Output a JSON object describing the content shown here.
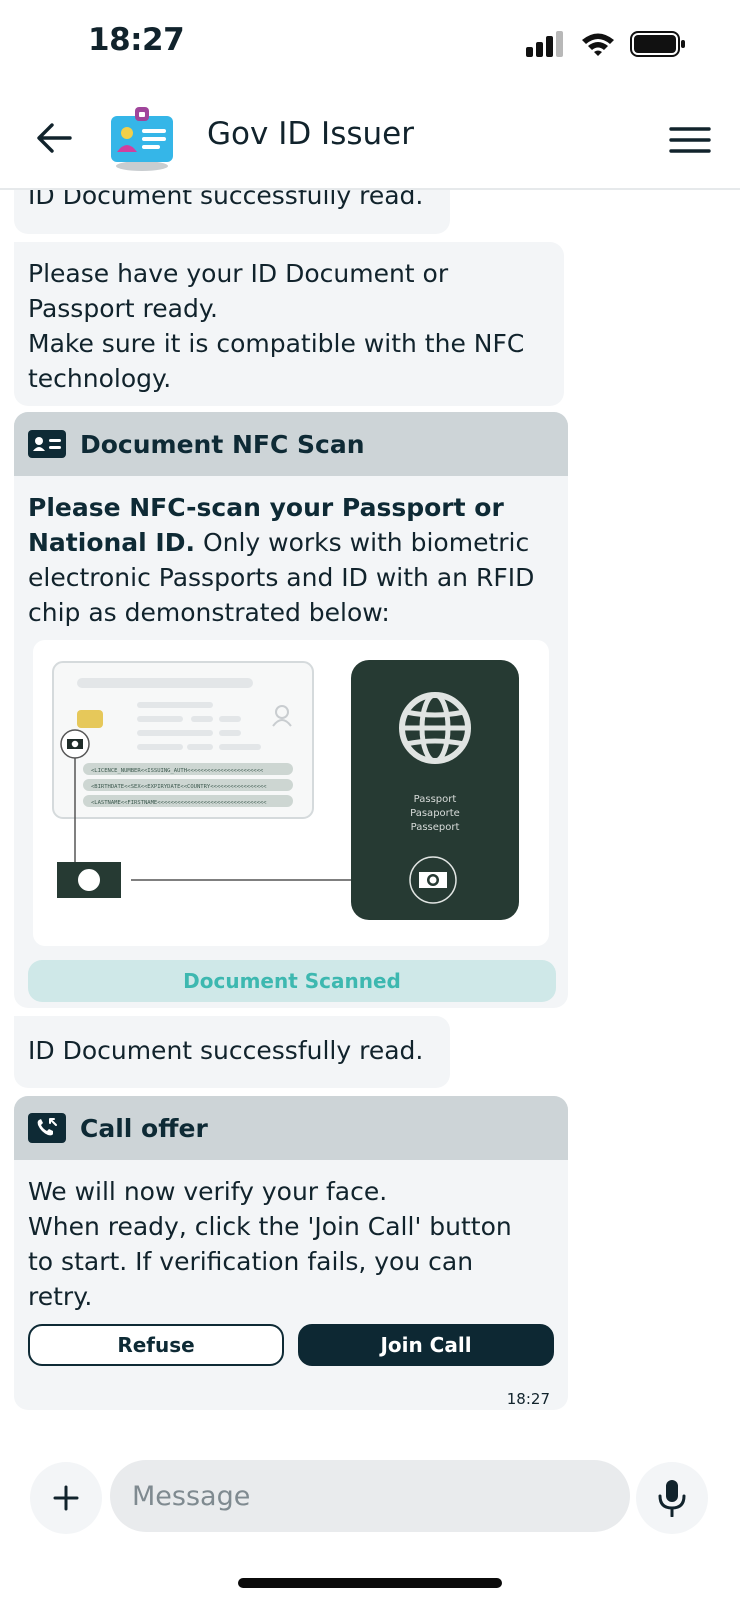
{
  "status_bar": {
    "time": "18:27"
  },
  "header": {
    "title": "Gov ID Issuer"
  },
  "messages": {
    "top_partial": "ID Document successfully read.",
    "prepare": [
      "Please have your ID Document or",
      "Passport ready.",
      "Make sure it is compatible with the NFC",
      "technology."
    ],
    "nfc_card": {
      "title": "Document NFC Scan",
      "bold_text": "Please NFC-scan your Passport or National ID.",
      "body_text": "Only works with biometric electronic Passports and ID with an RFID chip as demonstrated below:",
      "mrz_lines": [
        "<LICENCE_NUMBER<<ISSUING_AUTH<<<<<<<<<<<<<<<<<<<<<<<",
        "<BIRTHDATE<<SEX<<EXPIRYDATE<<COUNTRY<<<<<<<<<<<<<<<<<",
        "<LASTNAME<<FIRSTNAME<<<<<<<<<<<<<<<<<<<<<<<<<<<<<<<<<"
      ],
      "passport_words": [
        "Passport",
        "Pasaporte",
        "Passeport"
      ],
      "status": "Document Scanned"
    },
    "read_ok": "ID Document successfully read.",
    "call_card": {
      "title": "Call offer",
      "body": [
        "We will now verify your face.",
        "When ready, click the 'Join Call' button",
        "to start. If verification fails, you can",
        "retry."
      ],
      "refuse_label": "Refuse",
      "join_label": "Join Call",
      "time": "18:27"
    }
  },
  "composer": {
    "placeholder": "Message"
  },
  "colors": {
    "primary": "#0d2833",
    "card_header": "#cdd4d7",
    "bubble": "#f3f5f7",
    "scanned_bg": "#cfe8e8",
    "scanned_text": "#3db8b0",
    "passport": "#263a33"
  }
}
